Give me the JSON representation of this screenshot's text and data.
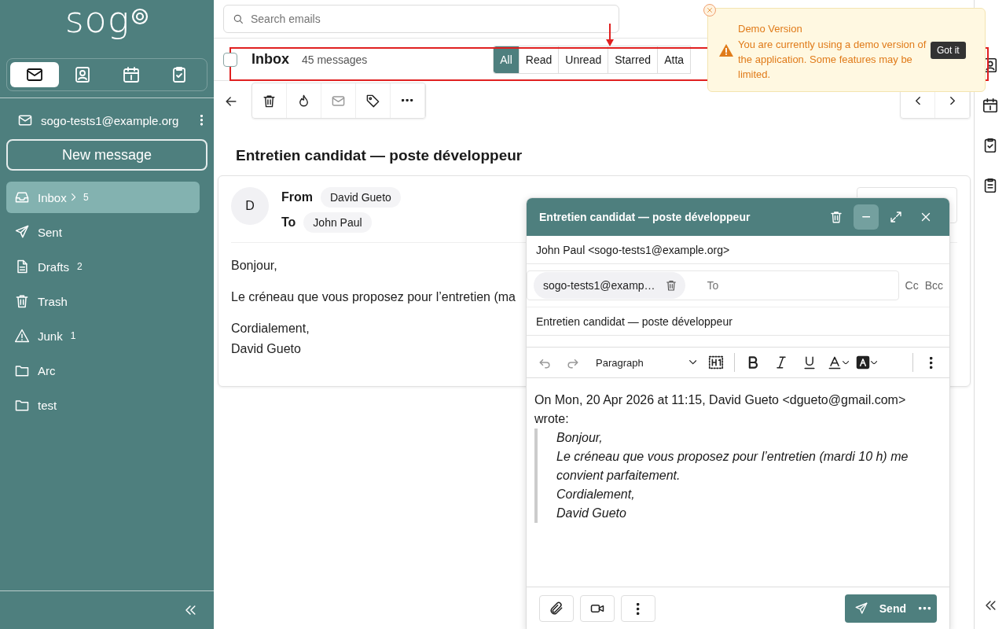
{
  "logo": {
    "text": "sog"
  },
  "module_tabs": [
    {
      "kind": "mail",
      "selected": true
    },
    {
      "kind": "contacts",
      "selected": false
    },
    {
      "kind": "calendar",
      "selected": false
    },
    {
      "kind": "tasks",
      "selected": false
    }
  ],
  "account": {
    "email": "sogo-tests1@example.org"
  },
  "new_message_button": "New message",
  "folders": [
    {
      "kind": "inbox",
      "label": "Inbox",
      "count": "5",
      "expandable": true,
      "selected": true
    },
    {
      "kind": "sent",
      "label": "Sent",
      "selected": false
    },
    {
      "kind": "drafts",
      "label": "Drafts",
      "count": "2",
      "selected": false
    },
    {
      "kind": "trash",
      "label": "Trash",
      "selected": false
    },
    {
      "kind": "junk",
      "label": "Junk",
      "count": "1",
      "selected": false
    },
    {
      "kind": "folder",
      "label": "Arc",
      "selected": false
    },
    {
      "kind": "folder",
      "label": "test",
      "selected": false
    }
  ],
  "search": {
    "placeholder": "Search emails"
  },
  "list_header": {
    "title": "Inbox",
    "count": "45 messages",
    "checked": false,
    "filters": [
      {
        "label": "All",
        "selected": true
      },
      {
        "label": "Read",
        "selected": false
      },
      {
        "label": "Unread",
        "selected": false
      },
      {
        "label": "Starred",
        "selected": false
      },
      {
        "label": "Atta",
        "selected": false
      }
    ]
  },
  "message": {
    "subject": "Entretien candidat — poste développeur",
    "avatar": "D",
    "from_label": "From",
    "from": "David Gueto",
    "to_label": "To",
    "to": "John Paul",
    "body": [
      "Bonjour,",
      "Le créneau que vous proposez pour l’entretien (ma",
      "Cordialement,\nDavid Gueto"
    ]
  },
  "compose": {
    "title": "Entretien candidat — poste développeur",
    "from": "John Paul <sogo-tests1@example.org>",
    "recipients": [
      "sogo-tests1@examp…"
    ],
    "to_placeholder": "To",
    "cc": "Cc",
    "bcc": "Bcc",
    "subject": "Entretien candidat — poste développeur",
    "format": "Paragraph",
    "intro": "On Mon, 20 Apr 2026 at 11:15, David Gueto <dgueto@gmail.com> wrote:",
    "quote": [
      "Bonjour,",
      "Le créneau que vous proposez pour l’entretien (mardi 10 h) me convient parfaitement.",
      "Cordialement,",
      "David Gueto"
    ],
    "send": "Send"
  },
  "toast": {
    "title": "Demo Version",
    "message": "You are currently using a demo version of the application. Some features may be limited.",
    "button": "Got it"
  }
}
